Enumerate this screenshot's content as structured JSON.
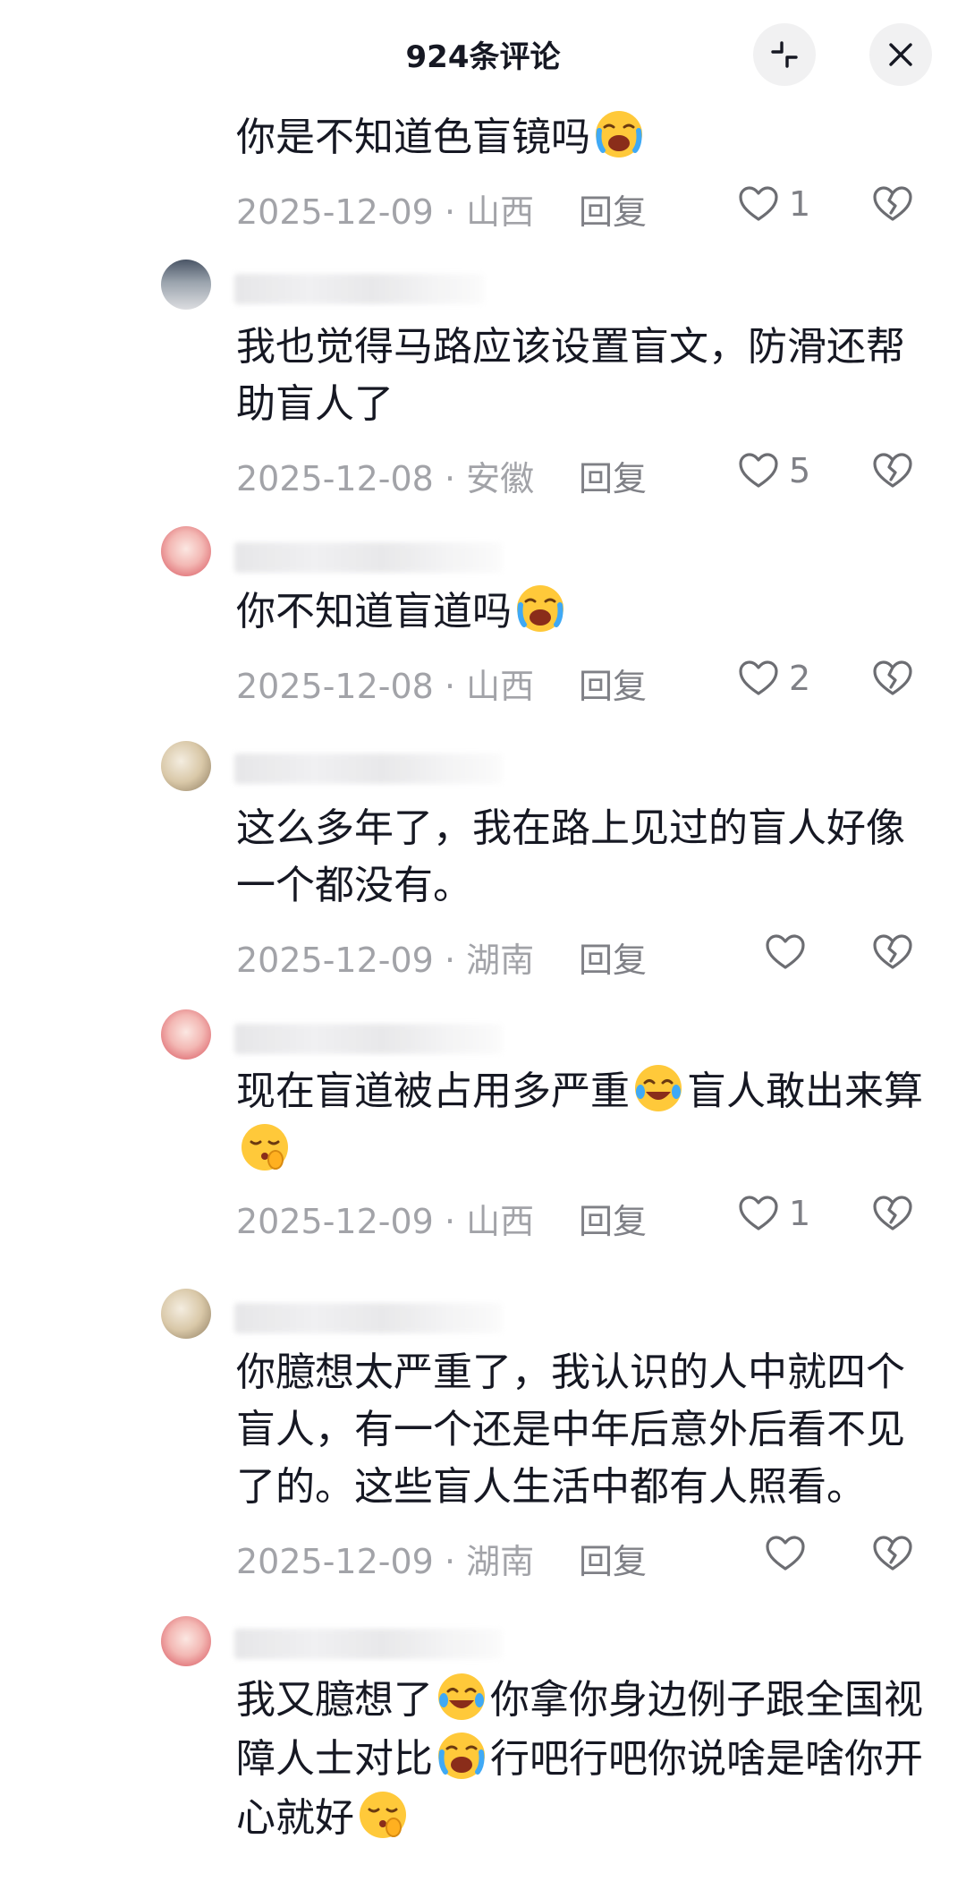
{
  "header": {
    "title": "924条评论",
    "collapse_icon": "collapse-icon",
    "close_icon": "close-icon"
  },
  "colors": {
    "text": "#161823",
    "meta": "#a2a3a8",
    "reply": "#7f8086",
    "button_bg": "#f1f1f2"
  },
  "comments": [
    {
      "segments": [
        "你是不知道色盲镜吗",
        ""
      ],
      "emoji": [
        "loudly-crying-face"
      ],
      "date": "2025-12-09",
      "sep": "·",
      "location": "山西",
      "reply": "回复",
      "likes": "1"
    },
    {
      "segments": [
        "我也觉得马路应该设置盲文，防滑还帮助盲人了"
      ],
      "emoji": [],
      "date": "2025-12-08",
      "sep": "·",
      "location": "安徽",
      "reply": "回复",
      "likes": "5"
    },
    {
      "segments": [
        "你不知道盲道吗",
        ""
      ],
      "emoji": [
        "loudly-crying-face"
      ],
      "date": "2025-12-08",
      "sep": "·",
      "location": "山西",
      "reply": "回复",
      "likes": "2"
    },
    {
      "segments": [
        "这么多年了，我在路上见过的盲人好像一个都没有。"
      ],
      "emoji": [],
      "date": "2025-12-09",
      "sep": "·",
      "location": "湖南",
      "reply": "回复",
      "likes": ""
    },
    {
      "segments": [
        "现在盲道被占用多严重",
        "盲人敢出来算",
        ""
      ],
      "emoji": [
        "tears-of-joy-face",
        "shushing-face"
      ],
      "date": "2025-12-09",
      "sep": "·",
      "location": "山西",
      "reply": "回复",
      "likes": "1"
    },
    {
      "segments": [
        "你臆想太严重了，我认识的人中就四个盲人，有一个还是中年后意外后看不见了的。这些盲人生活中都有人照看。"
      ],
      "emoji": [],
      "date": "2025-12-09",
      "sep": "·",
      "location": "湖南",
      "reply": "回复",
      "likes": ""
    },
    {
      "segments": [
        "我又臆想了",
        "你拿你身边例子跟全国视障人士对比",
        "行吧行吧你说啥是啥你开心就好",
        ""
      ],
      "emoji": [
        "tears-of-joy-face",
        "loudly-crying-face",
        "shushing-face"
      ],
      "date": "",
      "sep": "",
      "location": "",
      "reply": "",
      "likes": ""
    }
  ]
}
